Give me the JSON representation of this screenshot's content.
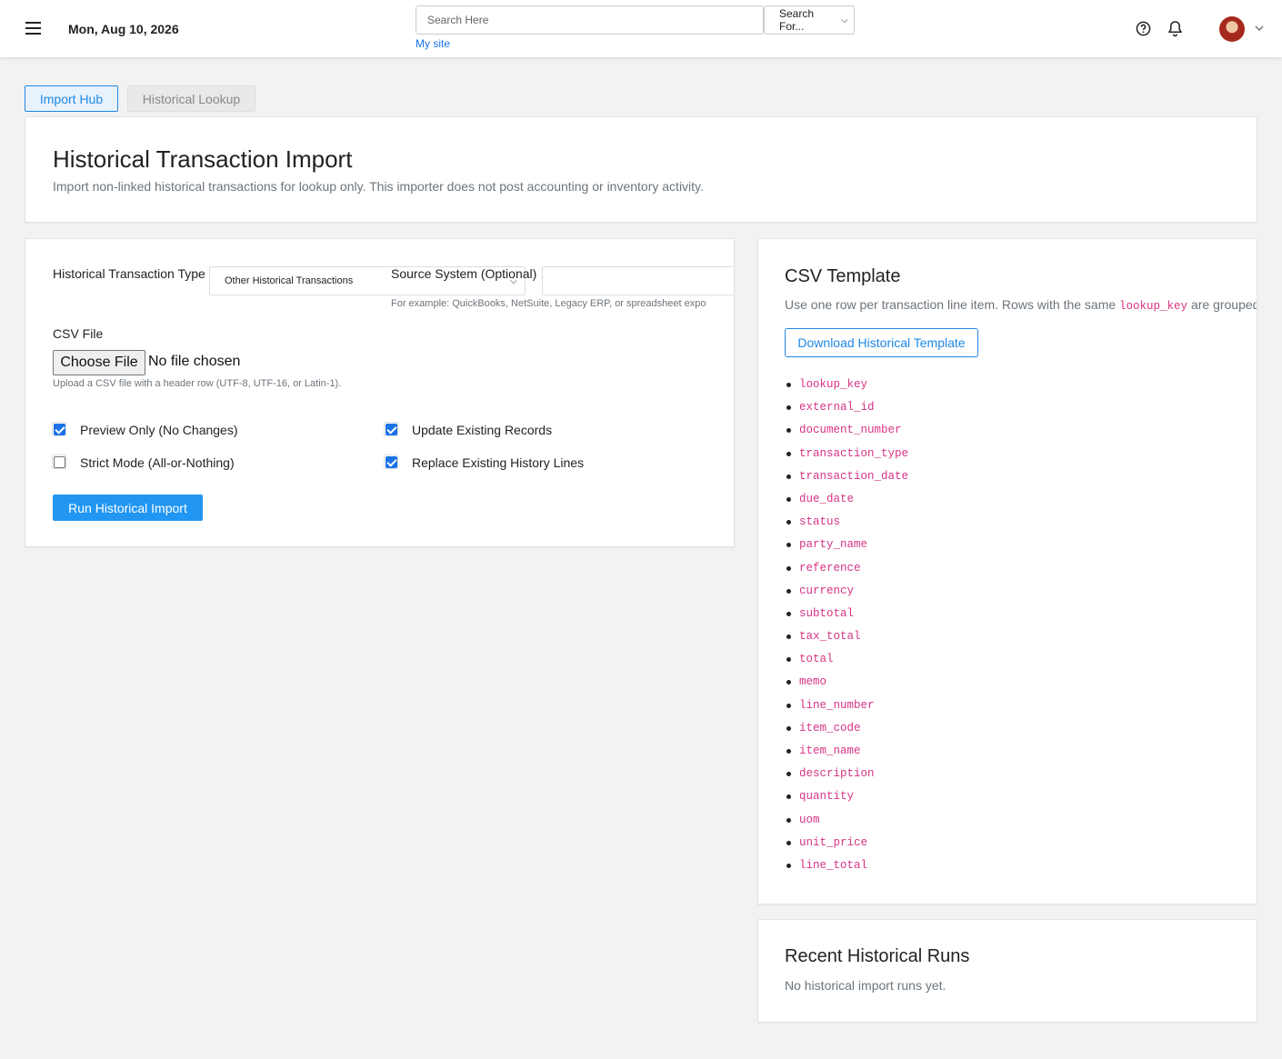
{
  "topbar": {
    "date": "Mon, Aug 10, 2026",
    "search_placeholder": "Search Here",
    "search_scope": "Search For...",
    "my_site": "My site"
  },
  "tabs": [
    {
      "label": "Import Hub",
      "active": true
    },
    {
      "label": "Historical Lookup",
      "active": false
    }
  ],
  "header": {
    "title": "Historical Transaction Import",
    "subtitle": "Import non-linked historical transactions for lookup only. This importer does not post accounting or inventory activity."
  },
  "form": {
    "type_label": "Historical Transaction Type",
    "type_value": "Other Historical Transactions",
    "source_label": "Source System (Optional)",
    "source_help": "For example: QuickBooks, NetSuite, Legacy ERP, or spreadsheet expo",
    "csv_label": "CSV File",
    "file_button": "Choose File",
    "file_status": "No file chosen",
    "file_help": "Upload a CSV file with a header row (UTF-8, UTF-16, or Latin-1).",
    "options": [
      {
        "label": "Preview Only (No Changes)",
        "checked": true
      },
      {
        "label": "Update Existing Records",
        "checked": true
      },
      {
        "label": "Strict Mode (All-or-Nothing)",
        "checked": false
      },
      {
        "label": "Replace Existing History Lines",
        "checked": true
      }
    ],
    "run_button": "Run Historical Import"
  },
  "template": {
    "title": "CSV Template",
    "desc_prefix": "Use one row per transaction line item. Rows with the same ",
    "desc_code": "lookup_key",
    "desc_suffix": " are grouped",
    "download_button": "Download Historical Template",
    "columns": [
      "lookup_key",
      "external_id",
      "document_number",
      "transaction_type",
      "transaction_date",
      "due_date",
      "status",
      "party_name",
      "reference",
      "currency",
      "subtotal",
      "tax_total",
      "total",
      "memo",
      "line_number",
      "item_code",
      "item_name",
      "description",
      "quantity",
      "uom",
      "unit_price",
      "line_total"
    ]
  },
  "recent_runs": {
    "title": "Recent Historical Runs",
    "empty": "No historical import runs yet."
  },
  "colors": {
    "accent": "#2196f3",
    "code": "#d63384"
  }
}
